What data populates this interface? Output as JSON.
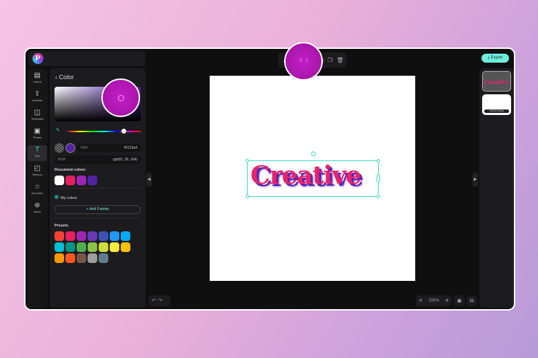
{
  "app": {
    "logo_letter": "P"
  },
  "rail": [
    {
      "label": "Layout",
      "icon": "layout-icon"
    },
    {
      "label": "Uploads",
      "icon": "upload-icon"
    },
    {
      "label": "Templates",
      "icon": "templates-icon"
    },
    {
      "label": "Photos",
      "icon": "photos-icon"
    },
    {
      "label": "Text",
      "icon": "text-icon",
      "active": true
    },
    {
      "label": "Stickers",
      "icon": "stickers-icon"
    },
    {
      "label": "Elements",
      "icon": "star-icon"
    },
    {
      "label": "Batch",
      "icon": "batch-icon"
    }
  ],
  "panel": {
    "title": "Color",
    "hex_label": "HEX",
    "hex_value": "#5123a4",
    "rgb_label": "RGB",
    "rgb_value": "rgb(81, 35, 164)",
    "document_colors_label": "Document colors",
    "document_colors": [
      "#ffffff",
      "#e91e63",
      "#9c27b0",
      "#5123a4"
    ],
    "my_colors_label": "My colors",
    "add_palette": "+ Add Palette",
    "presets_label": "Presets",
    "presets": [
      "#f44336",
      "#e91e63",
      "#9c27b0",
      "#673ab7",
      "#3f51b5",
      "#2196f3",
      "#03a9f4",
      "#00bcd4",
      "#009688",
      "#4caf50",
      "#8bc34a",
      "#cddc39",
      "#ffeb3b",
      "#ffc107",
      "#ff9800",
      "#ff5722",
      "#795548",
      "#9e9e9e",
      "#607d8b"
    ],
    "hue_percent": 73
  },
  "canvas": {
    "text": "Creative"
  },
  "header": {
    "export": "⤓ Export"
  },
  "pages": {
    "size_label": "1200x1200px"
  },
  "zoom": {
    "value": "100%"
  }
}
